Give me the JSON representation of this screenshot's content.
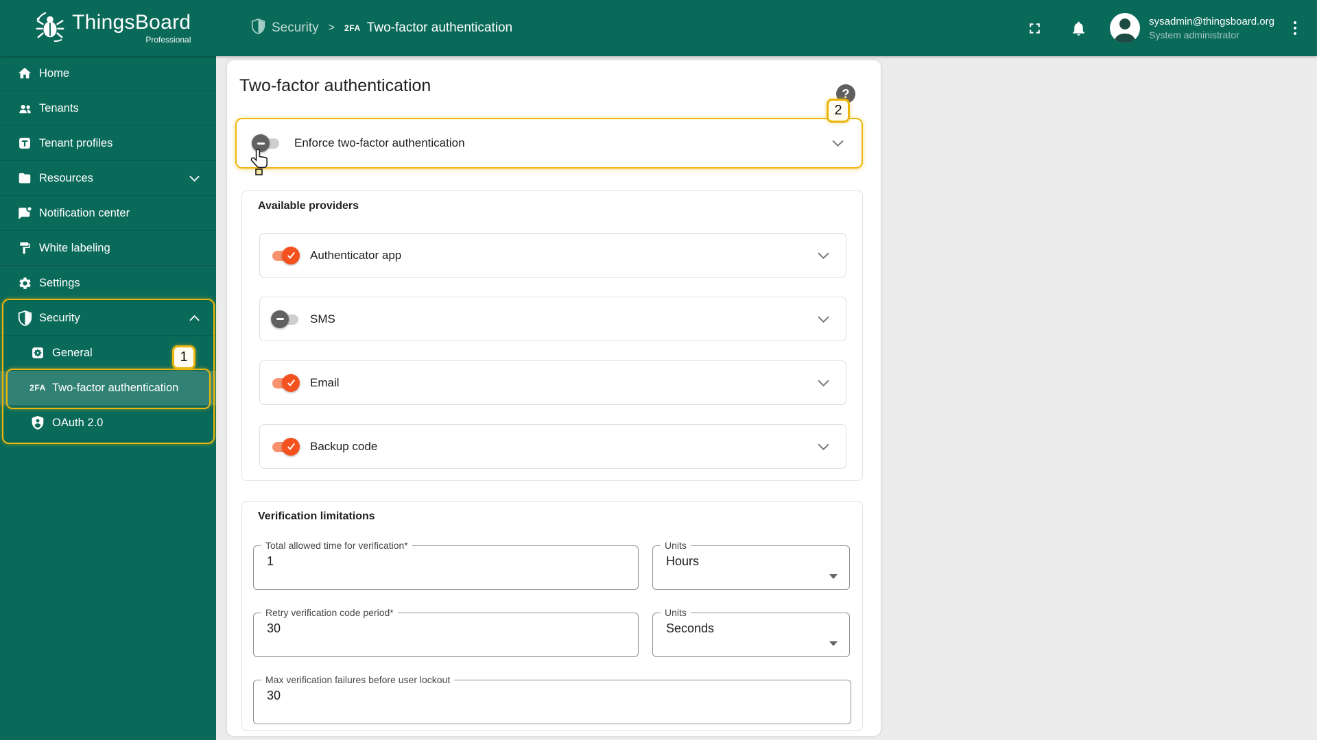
{
  "colors": {
    "primary": "#0A6A5A",
    "highlight_yellow": "#EEB70C",
    "toggle_on": "#F4511E",
    "toggle_on_track": "#F9926E",
    "toggle_off": "#616161",
    "page_bg": "#ECECEC"
  },
  "header": {
    "logo": {
      "title": "ThingsBoard",
      "subtitle": "Professional"
    },
    "breadcrumb": {
      "section": "Security",
      "separator": ">",
      "page_icon": "2FA",
      "page": "Two-factor authentication"
    },
    "user": {
      "email": "sysadmin@thingsboard.org",
      "role": "System administrator"
    }
  },
  "sidebar": {
    "items": [
      {
        "label": "Home"
      },
      {
        "label": "Tenants"
      },
      {
        "label": "Tenant profiles"
      },
      {
        "label": "Resources"
      },
      {
        "label": "Notification center"
      },
      {
        "label": "White labeling"
      },
      {
        "label": "Settings"
      },
      {
        "label": "Security"
      },
      {
        "label": "General"
      },
      {
        "label": "Two-factor authentication",
        "icon_text": "2FA"
      },
      {
        "label": "OAuth 2.0"
      }
    ]
  },
  "annotations": {
    "step1": "1",
    "step2": "2"
  },
  "main": {
    "title": "Two-factor authentication",
    "help_glyph": "?",
    "enforce": {
      "label": "Enforce two-factor authentication",
      "enabled": false
    },
    "providers": {
      "heading": "Available providers",
      "items": [
        {
          "label": "Authenticator app",
          "enabled": true
        },
        {
          "label": "SMS",
          "enabled": false
        },
        {
          "label": "Email",
          "enabled": true
        },
        {
          "label": "Backup code",
          "enabled": true
        }
      ]
    },
    "limits": {
      "heading": "Verification limitations",
      "total": {
        "label": "Total allowed time for verification*",
        "value": "1"
      },
      "total_units": {
        "label": "Units",
        "value": "Hours"
      },
      "retry": {
        "label": "Retry verification code period*",
        "value": "30"
      },
      "retry_units": {
        "label": "Units",
        "value": "Seconds"
      },
      "max_failures": {
        "label": "Max verification failures before user lockout",
        "value": "30"
      }
    }
  }
}
